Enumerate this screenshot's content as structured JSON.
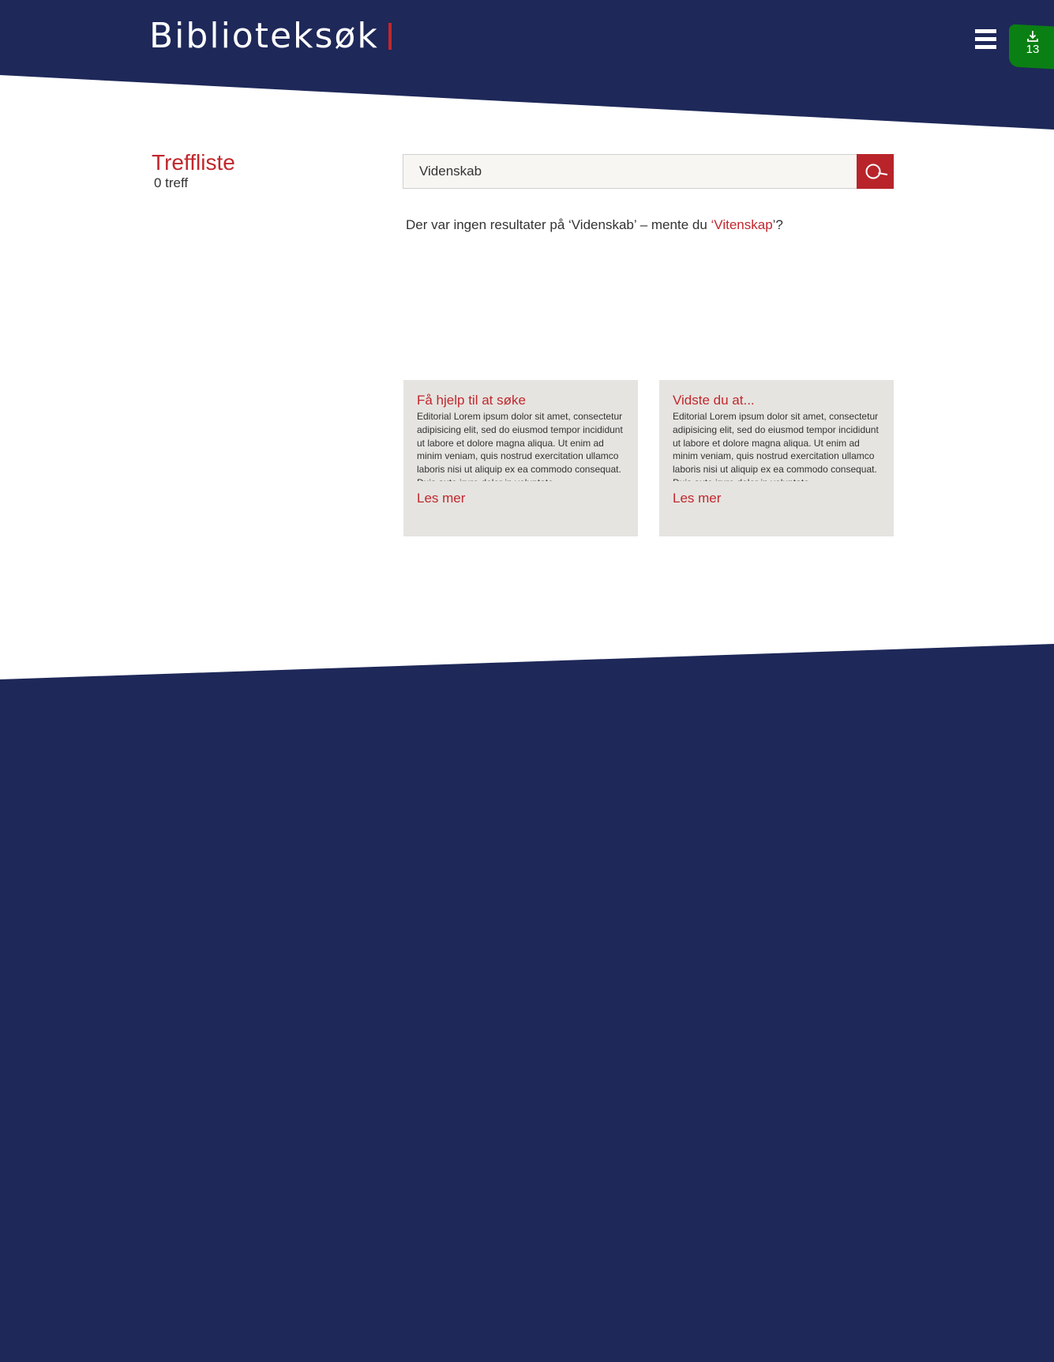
{
  "header": {
    "logo_text": "Biblioteksøk",
    "menu_icon": "hamburger-menu-icon",
    "download": {
      "icon": "download-icon",
      "count": "13"
    }
  },
  "results": {
    "title": "Treffliste",
    "count_text": "0 treff"
  },
  "search": {
    "value": "Videnskab",
    "button_icon": "search-icon"
  },
  "message": {
    "prefix": "Der var ingen resultater på ‘Videnskab’ – mente du ",
    "suggestion_open": "‘",
    "suggestion": "Vitenskap",
    "suffix": "’?"
  },
  "cards": [
    {
      "title": "Få hjelp til at søke",
      "body": "Editorial Lorem ipsum dolor sit amet, consectetur adipisicing elit, sed do eiusmod tempor incididunt ut labore et dolore magna aliqua. Ut enim ad minim veniam, quis nostrud exercitation ullamco laboris nisi ut aliquip ex ea commodo consequat. Duis aute irure dolor in.voluptate...",
      "link": "Les mer"
    },
    {
      "title": "Vidste du at...",
      "body": "Editorial Lorem ipsum dolor sit amet, consectetur adipisicing elit, sed do eiusmod tempor incididunt ut labore et dolore magna aliqua. Ut enim ad minim veniam, quis nostrud exercitation ullamco laboris nisi ut aliquip ex ea commodo consequat. Duis aute irure dolor in.voluptate...",
      "link": "Les mer"
    }
  ],
  "colors": {
    "navy": "#1e2859",
    "accent_red": "#c1272d",
    "badge_green": "#0a7f13",
    "card_bg": "#e6e4e0",
    "search_bg": "#f7f6f2"
  }
}
